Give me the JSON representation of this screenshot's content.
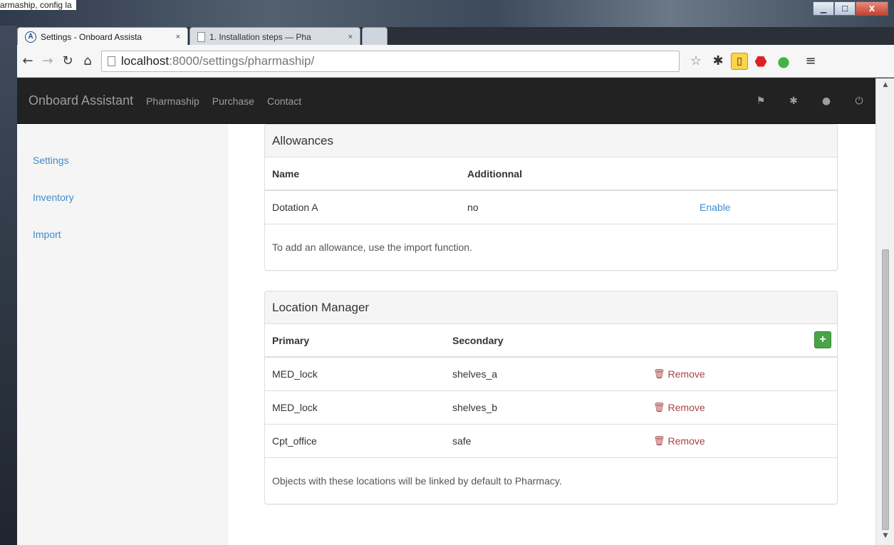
{
  "top_snippet": "armaship, config la",
  "window_controls": {
    "minimize": "▁",
    "maximize": "☐",
    "close": "X"
  },
  "tabs": [
    {
      "label": "Settings - Onboard Assista",
      "close": "×",
      "active": true
    },
    {
      "label": "1. Installation steps — Pha",
      "close": "×",
      "active": false
    }
  ],
  "address_bar": {
    "host": "localhost",
    "rest": ":8000/settings/pharmaship/"
  },
  "navbar": {
    "brand": "Onboard Assistant",
    "links": [
      "Pharmaship",
      "Purchase",
      "Contact"
    ],
    "icons": [
      "flag-icon",
      "gear-icon",
      "user-icon",
      "power-icon"
    ]
  },
  "sidebar": {
    "items": [
      "Settings",
      "Inventory",
      "Import"
    ]
  },
  "allowances": {
    "title": "Allowances",
    "headers": {
      "name": "Name",
      "additional": "Additionnal"
    },
    "rows": [
      {
        "name": "Dotation A",
        "additional": "no",
        "action": "Enable"
      }
    ],
    "note": "To add an allowance, use the import function."
  },
  "location_manager": {
    "title": "Location Manager",
    "headers": {
      "primary": "Primary",
      "secondary": "Secondary"
    },
    "add_label": "+",
    "rows": [
      {
        "primary": "MED_lock",
        "secondary": "shelves_a",
        "action": "Remove"
      },
      {
        "primary": "MED_lock",
        "secondary": "shelves_b",
        "action": "Remove"
      },
      {
        "primary": "Cpt_office",
        "secondary": "safe",
        "action": "Remove"
      }
    ],
    "note": "Objects with these locations will be linked by default to Pharmacy."
  },
  "colors": {
    "navbar_bg": "#222222",
    "link": "#428bca",
    "remove": "#a94442",
    "add_button": "#47a447"
  }
}
